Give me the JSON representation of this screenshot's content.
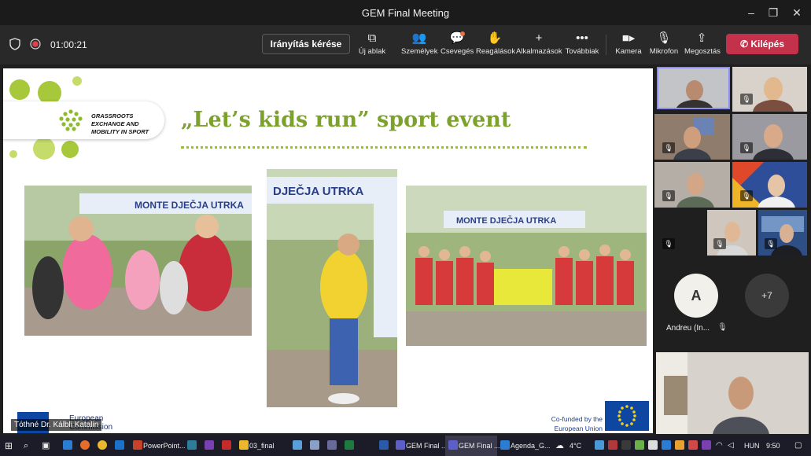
{
  "window": {
    "title": "GEM Final Meeting"
  },
  "toolbar": {
    "timer": "01:00:21",
    "request_control": "Irányítás kérése",
    "new_window": "Új ablak",
    "people": "Személyek",
    "chat": "Csevegés",
    "react": "Reagálások",
    "apps": "Alkalmazások",
    "more": "Továbbiak",
    "camera": "Kamera",
    "mic": "Mikrofon",
    "share": "Megosztás",
    "leave": "Kilépés"
  },
  "slide": {
    "logo_text": "GRASSROOTS EXCHANGE AND MOBILITY IN SPORT",
    "title": "„Let’s kids run” sport event",
    "photo_banner_1": "MONTE DJEČJA UTRKA",
    "photo_banner_2": "DJEČJA UTRKA",
    "photo_banner_3": "MONTE DJEČJA UTRKA",
    "eu_text": "European Commission",
    "cofunded": "Co-funded by the European Union",
    "presenter": "Tóthné Dr. Kálbli Katalin"
  },
  "gallery": {
    "participant_initial": "A",
    "participant_name": "Andreu (In...",
    "more_count": "+7"
  },
  "taskbar": {
    "items": [
      "PowerPoint...",
      "03_final",
      "GEM Final ...",
      "GEM Final ...",
      "Agenda_G..."
    ],
    "weather": "4°C",
    "lang": "HUN",
    "time": "9:50"
  },
  "colors": {
    "leave": "#c4314b",
    "slide_title": "#7da22c",
    "accent_dot": "#a7c83a",
    "eu_blue": "#0e47a1"
  }
}
